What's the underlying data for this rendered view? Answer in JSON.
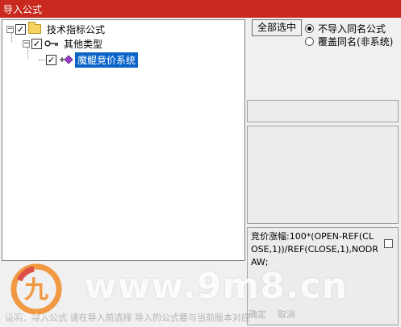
{
  "window": {
    "title": "导入公式"
  },
  "tree": {
    "root": {
      "label": "技术指标公式",
      "expander": "−",
      "checked": "✓",
      "icon": "folder-icon"
    },
    "child": {
      "label": "其他类型",
      "expander": "−",
      "checked": "✓",
      "icon": "key-icon"
    },
    "leaf": {
      "label": "魔鲲竞价系统",
      "checked": "✓",
      "icon": "formula-icon",
      "selected": true
    }
  },
  "controls": {
    "select_all_label": "全部选中",
    "radio_skip_label": "不导入同名公式",
    "radio_overwrite_label": "覆盖同名(非系统)"
  },
  "formula_preview": {
    "text": "竞价涨幅:100*(OPEN-REF(CLOSE,1))/REF(CLOSE,1),NODRAW;"
  },
  "status": {
    "text": "说明：导入公式 请在导入前选择 导入的公式要与当前版本对应",
    "buttons": [
      "确定",
      "取消"
    ]
  },
  "watermark": {
    "logo_text": "九",
    "site": "www.9m8.cn",
    "site_small": "www.9m8.cn"
  },
  "colors": {
    "titlebar": "#c8281e",
    "selection": "#0a64c8",
    "watermark_orange": "#f08a24"
  }
}
